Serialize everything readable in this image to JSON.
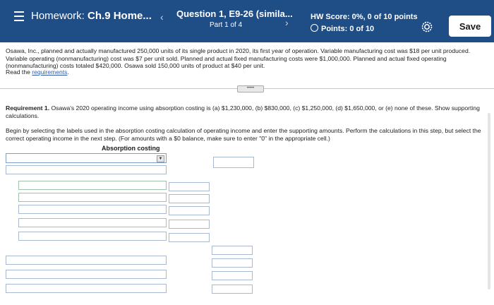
{
  "header": {
    "homework_label": "Homework:",
    "homework_name": "Ch.9 Home...",
    "question_title": "Question 1, E9-26 (simila...",
    "part": "Part 1 of 4",
    "score": "HW Score: 0%, 0 of 10 points",
    "points": "Points: 0 of 10",
    "save_label": "Save",
    "prev_arrow": "‹",
    "next_arrow": "›"
  },
  "problem": {
    "text": "Osawa, Inc., planned and actually manufactured 250,000 units of its single product in 2020, its first year of operation. Variable manufacturing cost was $18 per unit produced. Variable operating (nonmanufacturing) cost was $7 per unit sold. Planned and actual fixed manufacturing costs were $1,000,000. Planned and actual fixed operating (nonmanufacturing) costs totaled $420,000. Osawa sold 150,000 units of product at $40 per unit.",
    "read_prefix": "Read the ",
    "requirements_link": "requirements",
    "read_suffix": "."
  },
  "requirement": {
    "label": "Requirement 1.",
    "text": " Osawa's 2020 operating income using absorption costing is (a) $1,230,000, (b) $830,000, (c) $1,250,000, (d) $1,650,000, or (e) none of these. Show supporting calculations."
  },
  "instructions": "Begin by selecting the labels used in the absorption costing calculation of operating income and enter the supporting amounts. Perform the calculations in this step, but select the correct operating income in the next step. (For amounts with a $0 balance, make sure to enter \"0\" in the appropriate cell.)",
  "worksheet": {
    "header": "Absorption costing"
  },
  "colors": {
    "topbar": "#1f4d86",
    "link": "#2f5ea8"
  }
}
